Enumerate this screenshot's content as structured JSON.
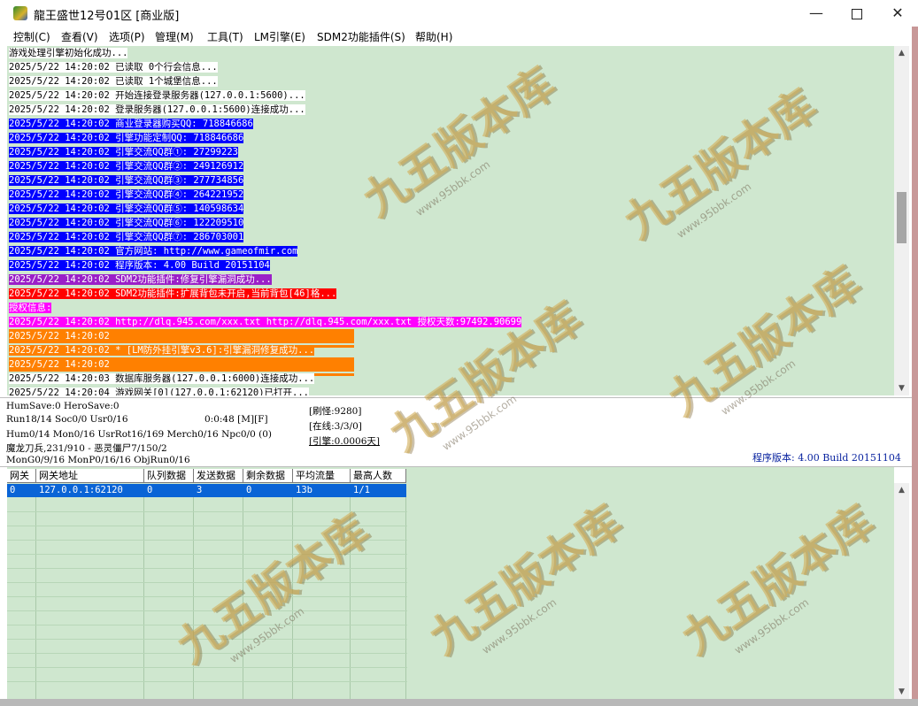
{
  "window": {
    "title": "龍王盛世12号01区 [商业版]",
    "minimize": "—",
    "close": "✕"
  },
  "menu": [
    "控制(C)",
    "查看(V)",
    "选项(P)",
    "管理(M)",
    "工具(T)",
    "LM引擎(E)",
    "SDM2功能插件(S)",
    "帮助(H)"
  ],
  "log": [
    {
      "text": "游戏处理引擎初始化成功...",
      "bg": "#ffffff",
      "fg": "#000000"
    },
    {
      "text": "2025/5/22 14:20:02 已读取 0个行会信息...",
      "bg": "#ffffff",
      "fg": "#000000"
    },
    {
      "text": "2025/5/22 14:20:02 已读取 1个城堡信息...",
      "bg": "#ffffff",
      "fg": "#000000"
    },
    {
      "text": "2025/5/22 14:20:02 开始连接登录服务器(127.0.0.1:5600)...",
      "bg": "#ffffff",
      "fg": "#000000"
    },
    {
      "text": "2025/5/22 14:20:02 登录服务器(127.0.0.1:5600)连接成功...",
      "bg": "#ffffff",
      "fg": "#000000"
    },
    {
      "text": "2025/5/22 14:20:02 商业登录器购买QQ: 718846686",
      "bg": "#0000ff",
      "fg": "#ffffff"
    },
    {
      "text": "2025/5/22 14:20:02 引擎功能定制QQ: 718846686",
      "bg": "#0000ff",
      "fg": "#ffffff"
    },
    {
      "text": "2025/5/22 14:20:02 引擎交流QQ群①: 27299223",
      "bg": "#0000ff",
      "fg": "#ffffff"
    },
    {
      "text": "2025/5/22 14:20:02 引擎交流QQ群②: 249126912",
      "bg": "#0000ff",
      "fg": "#ffffff"
    },
    {
      "text": "2025/5/22 14:20:02 引擎交流QQ群③: 277734856",
      "bg": "#0000ff",
      "fg": "#ffffff"
    },
    {
      "text": "2025/5/22 14:20:02 引擎交流QQ群④: 264221952",
      "bg": "#0000ff",
      "fg": "#ffffff"
    },
    {
      "text": "2025/5/22 14:20:02 引擎交流QQ群⑤: 140598634",
      "bg": "#0000ff",
      "fg": "#ffffff"
    },
    {
      "text": "2025/5/22 14:20:02 引擎交流QQ群⑥: 122209510",
      "bg": "#0000ff",
      "fg": "#ffffff"
    },
    {
      "text": "2025/5/22 14:20:02 引擎交流QQ群⑦: 286703001",
      "bg": "#0000ff",
      "fg": "#ffffff"
    },
    {
      "text": "2025/5/22 14:20:02 官方网站: http://www.gameofmir.com",
      "bg": "#0000ff",
      "fg": "#ffffff"
    },
    {
      "text": "2025/5/22 14:20:02 程序版本: 4.00 Build 20151104",
      "bg": "#0000ff",
      "fg": "#ffffff"
    },
    {
      "text": "2025/5/22 14:20:02 SDM2功能插件:修复引擎漏洞成功...",
      "bg": "#9b1fc8",
      "fg": "#ffffff"
    },
    {
      "text": "2025/5/22 14:20:02 SDM2功能插件:扩展背包未开启,当前背包[46]格...",
      "bg": "#ff0000",
      "fg": "#ffffff"
    },
    {
      "text": "授权信息:",
      "bg": "#ff00ff",
      "fg": "#ffffff"
    },
    {
      "text": "2025/5/22 14:20:02 http://dlq.945.com/xxx.txt http://dlq.945.com/xxx.txt 授权天数:97492.90699",
      "bg": "#ff00ff",
      "fg": "#ffffff"
    },
    {
      "text": "2025/5/22 14:20:02 ",
      "bg": "#ff8000",
      "fg": "#ffffff"
    },
    {
      "text": "",
      "bg": "#ff8000",
      "fg": "#ffffff"
    },
    {
      "text": "2025/5/22 14:20:02 * [LM防外挂引擎v3.6]:引擎漏洞修复成功...",
      "bg": "#ff8000",
      "fg": "#ffffff"
    },
    {
      "text": "2025/5/22 14:20:02 ",
      "bg": "#ff8000",
      "fg": "#ffffff"
    },
    {
      "text": "",
      "bg": "#ff8000",
      "fg": "#ffffff"
    },
    {
      "text": "2025/5/22 14:20:03 数据库服务器(127.0.0.1:6000)连接成功...",
      "bg": "#ffffff",
      "fg": "#000000"
    },
    {
      "text": "2025/5/22 14:20:04 游戏网关[0](127.0.0.1:62120)已打开...",
      "bg": "#ffffff",
      "fg": "#000000"
    }
  ],
  "status": {
    "hum_save": "HumSave:0 HeroSave:0",
    "run": "Run18/14 Soc0/0 Usr0/16",
    "timer": "0:0:48 [M][F]",
    "hum": "Hum0/14 Mon0/16 UsrRot16/169 Merch0/16 Npc0/0 (0)",
    "monster": "魔龙刀兵,231/910 - 恶灵僵尸7/150/2",
    "mon_gen": "MonG0/9/16 MonP0/16/16 ObjRun0/16",
    "refresh_monster": "[刷怪:9280]",
    "online": "[在线:3/3/0]",
    "engine": "[引擎:0.0006天]",
    "version": "程序版本: 4.00 Build 20151104"
  },
  "grid": {
    "columns": [
      "网关",
      "网关地址",
      "队列数据",
      "发送数据",
      "剩余数据",
      "平均流量",
      "最高人数"
    ],
    "rows": [
      [
        "0",
        "127.0.0.1:62120",
        "0",
        "3",
        "0",
        "13b",
        "1/1"
      ]
    ]
  },
  "watermark": {
    "text": "九五版本库",
    "url": "www.95bbk.com"
  },
  "colors": {
    "pane_bg": "#cfe7cf",
    "selection": "#0a64d6"
  }
}
